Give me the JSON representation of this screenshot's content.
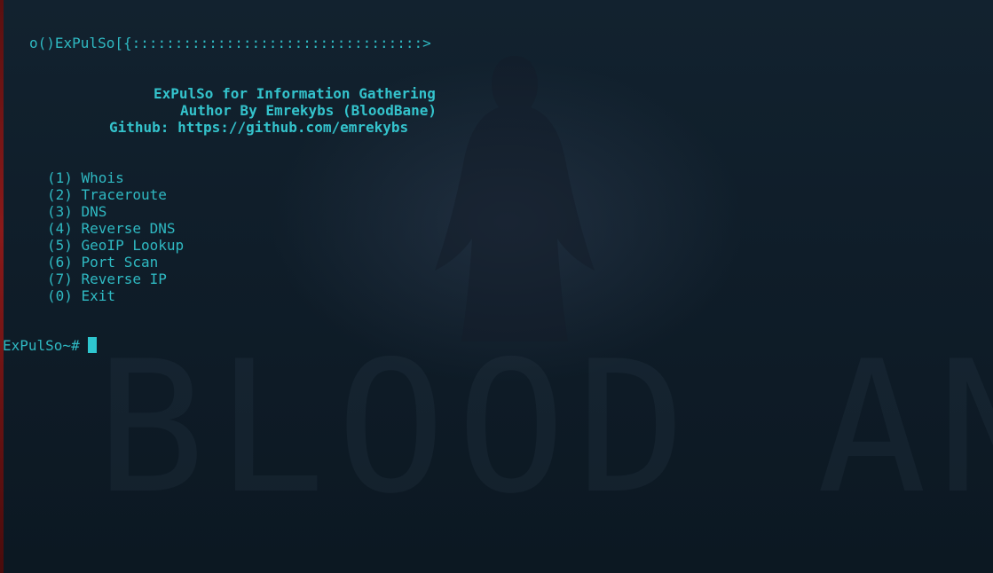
{
  "terminal": {
    "banner": "o()ExPulSo[{::::::::::::::::::::::::::::::::::>",
    "header": {
      "title": "ExPulSo for Information Gathering",
      "author": "Author By Emrekybs (BloodBane)",
      "github": "Github: https://github.com/emrekybs"
    },
    "menu": [
      {
        "label": "(1) Whois"
      },
      {
        "label": "(2) Traceroute"
      },
      {
        "label": "(3) DNS"
      },
      {
        "label": "(4) Reverse DNS"
      },
      {
        "label": "(5) GeoIP Lookup"
      },
      {
        "label": "(6) Port Scan"
      },
      {
        "label": "(7) Reverse IP"
      },
      {
        "label": "(0) Exit"
      }
    ],
    "prompt": "ExPulSo~# "
  },
  "colors": {
    "text": "#2fb9c2",
    "cursor": "#2ec6cf",
    "background": "#0f1b26"
  }
}
